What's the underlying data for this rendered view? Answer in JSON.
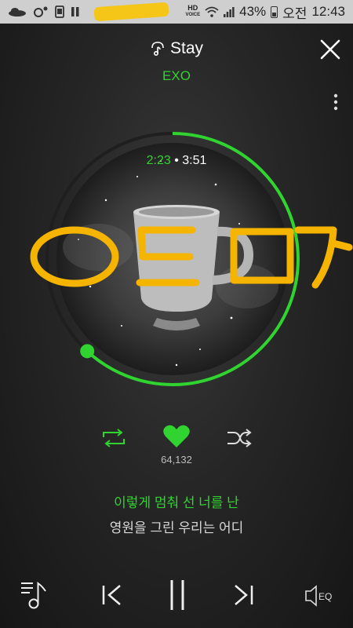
{
  "status_bar": {
    "battery": "43%",
    "ampm": "오전",
    "time": "12:43",
    "hd_label": "HD",
    "voice_label": "VOICE"
  },
  "header": {
    "title": "Stay",
    "artist": "EXO"
  },
  "player": {
    "current_time": "2:23",
    "separator": "•",
    "total_time": "3:51",
    "progress_fraction": 0.619,
    "likes": "64,132",
    "accent_color": "#31d331"
  },
  "annotation": {
    "handwritten_text": "ㅇㅌㅁㄱ",
    "color": "#f5b400"
  },
  "lyrics": {
    "current_line": "이렇게 멈춰 선 너를 난",
    "next_line": "영원을 그린 우리는 어디"
  },
  "bottom_bar": {
    "eq_label": "EQ"
  }
}
